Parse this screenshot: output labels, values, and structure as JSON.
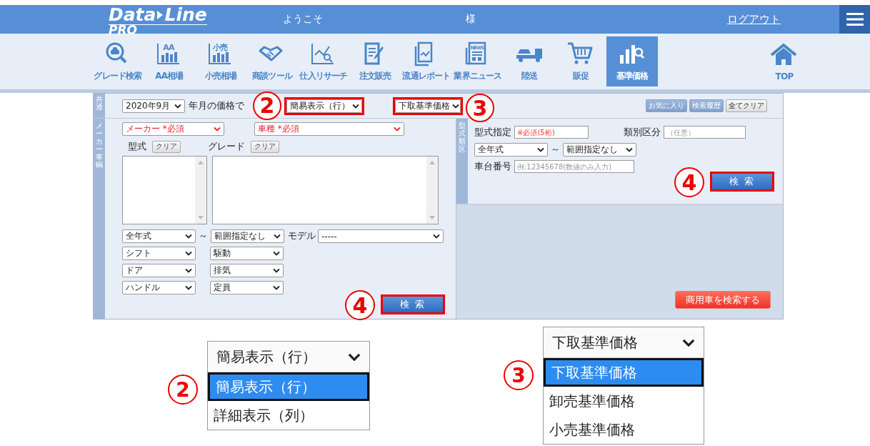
{
  "header": {
    "logo": {
      "word_1": "Data",
      "word_2": "Line",
      "sub": "PRO"
    },
    "welcome": "ようこそ",
    "honorific": "様",
    "logout": "ログアウト"
  },
  "nav": [
    {
      "label": "グレード検索",
      "kind": "car-search",
      "selected": false
    },
    {
      "label": "AA相場",
      "kind": "bar-chart",
      "badge": "AA",
      "selected": false
    },
    {
      "label": "小売相場",
      "kind": "bar-chart",
      "badge": "小売",
      "selected": false
    },
    {
      "label": "商談ツール",
      "kind": "handshake",
      "selected": false
    },
    {
      "label": "仕入リサーチ",
      "kind": "line-search",
      "selected": false
    },
    {
      "label": "注文販売",
      "kind": "document-pen",
      "selected": false
    },
    {
      "label": "流通レポート",
      "kind": "report",
      "selected": false
    },
    {
      "label": "業界ニュース",
      "kind": "newspaper",
      "badge": "NEWS",
      "selected": false
    },
    {
      "label": "陸送",
      "kind": "truck",
      "selected": false
    },
    {
      "label": "販促",
      "kind": "cart",
      "selected": false
    },
    {
      "label": "基準価格",
      "kind": "bars-search",
      "selected": true
    },
    {
      "label": "TOP",
      "kind": "house",
      "selected": false
    }
  ],
  "common": {
    "label": "共通",
    "month": "2020年9月",
    "month_suffix": "年月の価格で",
    "display": {
      "value": "簡易表示（行）",
      "highlighted": true,
      "marker": "2"
    },
    "price": {
      "value": "下取基準価格",
      "highlighted": true,
      "marker": "3"
    },
    "buttons": [
      {
        "label": "お気に入り",
        "kind": "blue"
      },
      {
        "label": "検索履歴",
        "kind": "blue"
      },
      {
        "label": "全てクリア",
        "kind": "grey"
      }
    ]
  },
  "maker_section": {
    "label": "メーカー・車輌",
    "maker": {
      "value": "メーカー *必須",
      "required": true
    },
    "model": {
      "value": "車種 *必須",
      "required": true
    },
    "katashiki_label": "型式",
    "katashiki_clear": "クリア",
    "grade_label": "グレード",
    "grade_clear": "クリア",
    "year_from": "全年式",
    "tilde": "～",
    "year_to": "範囲指定なし",
    "model_label": "モデル",
    "model_value": "-----",
    "filters": [
      [
        "シフト",
        "駆動"
      ],
      [
        "ドア",
        "排気"
      ],
      [
        "ハンドル",
        "定員"
      ]
    ],
    "search": {
      "label": "検 索",
      "highlighted": true,
      "marker": "4"
    }
  },
  "type_section": {
    "label": "型式類区",
    "type_label": "型式指定",
    "type_placeholder": "※必須(5桁)",
    "class_label": "類別区分",
    "class_placeholder": "（任意）",
    "year_from": "全年式",
    "tilde": "～",
    "year_to": "範囲指定なし",
    "chassis_label": "車台番号",
    "chassis_placeholder": "例:12345678(数値のみ入力)",
    "search": {
      "label": "検 索",
      "highlighted": true,
      "marker": "4"
    },
    "commercial_button": "商用車を検索する"
  },
  "callouts": [
    {
      "marker": "2",
      "value": "簡易表示（行）",
      "options": [
        {
          "label": "簡易表示（行）",
          "selected": true
        },
        {
          "label": "詳細表示（列）",
          "selected": false
        }
      ]
    },
    {
      "marker": "3",
      "value": "下取基準価格",
      "options": [
        {
          "label": "下取基準価格",
          "selected": true
        },
        {
          "label": "卸売基準価格",
          "selected": false
        },
        {
          "label": "小売基準価格",
          "selected": false
        }
      ]
    }
  ]
}
